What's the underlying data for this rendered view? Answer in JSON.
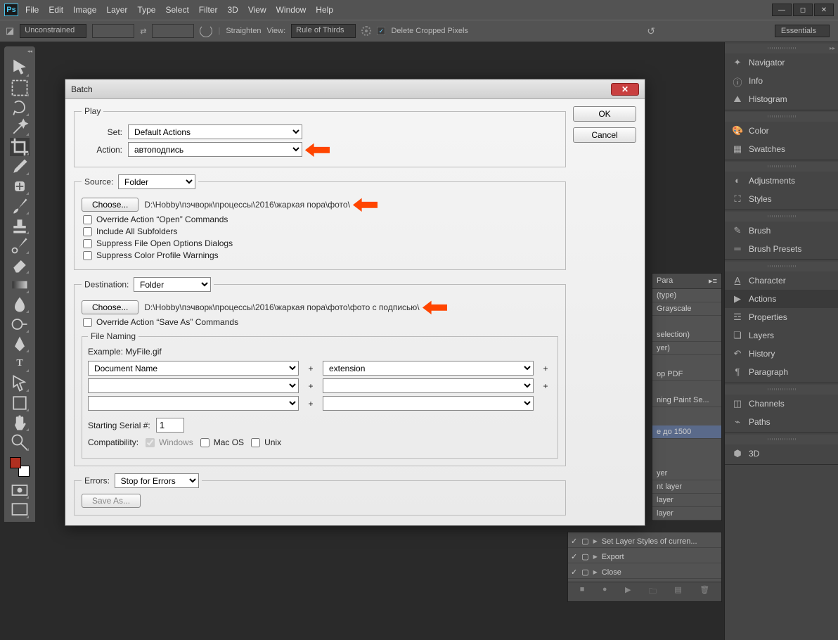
{
  "app": {
    "logo": "Ps"
  },
  "menus": [
    "File",
    "Edit",
    "Image",
    "Layer",
    "Type",
    "Select",
    "Filter",
    "3D",
    "View",
    "Window",
    "Help"
  ],
  "optbar": {
    "constrain": "Unconstrained",
    "straighten": "Straighten",
    "view_lbl": "View:",
    "view_val": "Rule of Thirds",
    "delete_cropped": "Delete Cropped Pixels",
    "workspace": "Essentials"
  },
  "panels": {
    "groups": [
      [
        "Navigator",
        "Info",
        "Histogram"
      ],
      [
        "Color",
        "Swatches"
      ],
      [
        "Adjustments",
        "Styles"
      ],
      [
        "Brush",
        "Brush Presets"
      ],
      [
        "Character",
        "Actions",
        "Properties",
        "Layers",
        "History",
        "Paragraph"
      ],
      [
        "Channels",
        "Paths"
      ],
      [
        "3D"
      ]
    ],
    "selected": "Actions"
  },
  "bg_panel": {
    "tab": "Para",
    "rows": [
      "(type)",
      "Grayscale",
      "selection)",
      "yer)",
      "op PDF",
      "ning Paint Se...",
      "e до 1500",
      "yer",
      "nt layer",
      "layer",
      "layer"
    ],
    "rows2": [
      "Set Layer Styles of curren...",
      "Export",
      "Close"
    ]
  },
  "dialog": {
    "title": "Batch",
    "ok": "OK",
    "cancel": "Cancel",
    "play_legend": "Play",
    "set_lbl": "Set:",
    "set_val": "Default Actions",
    "action_lbl": "Action:",
    "action_val": "автоподпись",
    "source_legend": "Source:",
    "source_val": "Folder",
    "choose": "Choose...",
    "source_path": "D:\\Hobby\\пэчворк\\процессы\\2016\\жаркая пора\\фото\\",
    "override_open": "Override Action “Open” Commands",
    "include_subs": "Include All Subfolders",
    "suppress_open": "Suppress File Open Options Dialogs",
    "suppress_color": "Suppress Color Profile Warnings",
    "dest_lbl": "Destination:",
    "dest_val": "Folder",
    "dest_path": "D:\\Hobby\\пэчворк\\процессы\\2016\\жаркая пора\\фото\\фото с подписью\\",
    "override_save": "Override Action “Save As” Commands",
    "naming_legend": "File Naming",
    "example_lbl": "Example: MyFile.gif",
    "name1": "Document Name",
    "name2": "extension",
    "serial_lbl": "Starting Serial #:",
    "serial_val": "1",
    "compat_lbl": "Compatibility:",
    "compat_win": "Windows",
    "compat_mac": "Mac OS",
    "compat_unix": "Unix",
    "errors_lbl": "Errors:",
    "errors_val": "Stop for Errors",
    "saveas": "Save As..."
  }
}
